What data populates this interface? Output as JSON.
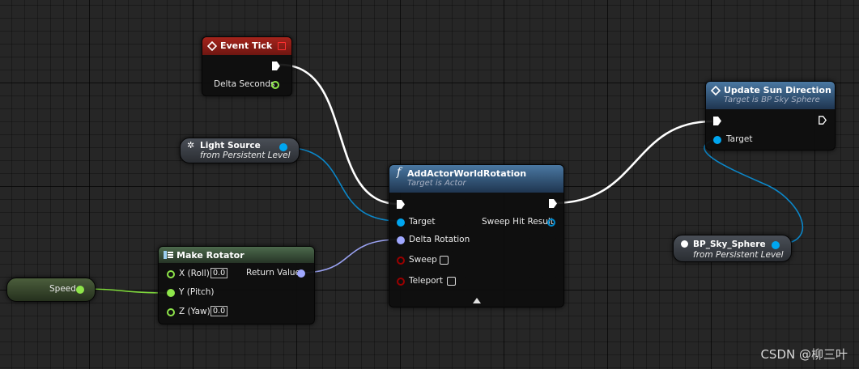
{
  "nodes": {
    "event_tick": {
      "title": "Event Tick",
      "pin_delta": "Delta Seconds"
    },
    "light_source": {
      "title": "Light Source",
      "subtitle": "from Persistent Level"
    },
    "make_rotator": {
      "title": "Make Rotator",
      "pin_x": "X (Roll)",
      "x_value": "0.0",
      "pin_y": "Y (Pitch)",
      "pin_z": "Z (Yaw)",
      "z_value": "0.0",
      "pin_return": "Return Value"
    },
    "speed": {
      "title": "Speed"
    },
    "add_rotation": {
      "function_glyph": "f",
      "title": "AddActorWorldRotation",
      "subtitle": "Target is Actor",
      "pin_target": "Target",
      "pin_delta_rotation": "Delta Rotation",
      "pin_sweep": "Sweep",
      "pin_teleport": "Teleport",
      "pin_sweep_hit": "Sweep Hit Result"
    },
    "update_sun": {
      "title": "Update Sun Direction",
      "subtitle": "Target is BP Sky Sphere",
      "pin_target": "Target"
    },
    "sky_sphere": {
      "title": "BP_Sky_Sphere",
      "subtitle": "from Persistent Level"
    }
  },
  "watermark": "CSDN @柳三叶",
  "colors": {
    "exec_wire": "#ffffff",
    "object_pin": "#00a6f0",
    "rotator_pin": "#a0a8ff",
    "float_pin": "#8ee54a",
    "bool_pin": "#9a0000",
    "event_header": "#8a1a14",
    "function_header": "#3b5f85",
    "struct_header": "#3c5a3c"
  }
}
